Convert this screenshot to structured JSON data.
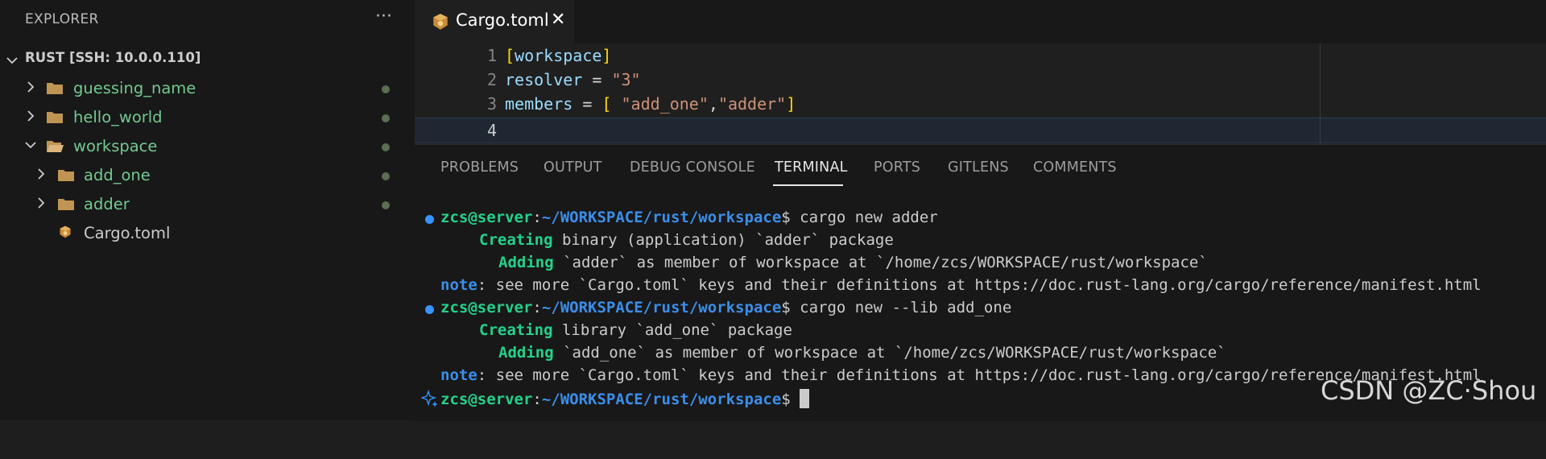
{
  "sidebar": {
    "title": "EXPLORER",
    "more_label": "···",
    "workspace_label": "RUST [SSH: 10.0.0.110]",
    "tree": [
      {
        "name": "guessing_name"
      },
      {
        "name": "hello_world"
      },
      {
        "name": "workspace"
      },
      {
        "name": "add_one"
      },
      {
        "name": "adder"
      },
      {
        "name": "Cargo.toml"
      }
    ]
  },
  "tab": {
    "label": "Cargo.toml",
    "close": "✕"
  },
  "editor": {
    "line_numbers": [
      "1",
      "2",
      "3",
      "4"
    ],
    "lines": [
      [
        "[",
        "workspace",
        "]"
      ],
      [
        "resolver",
        " = ",
        "\"3\""
      ],
      [
        "members",
        " = ",
        "[",
        " ",
        "\"add_one\"",
        ",",
        "\"adder\"",
        "]"
      ]
    ]
  },
  "panel": {
    "tabs": [
      "PROBLEMS",
      "OUTPUT",
      "DEBUG CONSOLE",
      "TERMINAL",
      "PORTS",
      "GITLENS",
      "COMMENTS"
    ],
    "active_tab": "TERMINAL"
  },
  "terminal": {
    "user_host": "zcs@server",
    "colon": ":",
    "path": "~/WORKSPACE/rust/workspace",
    "dollar": "$",
    "cmd1": " cargo new adder",
    "creating_word": "Creating",
    "adding_word": "Adding",
    "note_word": "note",
    "creating1_rest": " binary (application) `adder` package",
    "adding1_rest": " `adder` as member of workspace at `/home/zcs/WORKSPACE/rust/workspace`",
    "note_rest": ": see more `Cargo.toml` keys and their definitions at https://doc.rust-lang.org/cargo/reference/manifest.html",
    "cmd2": " cargo new --lib add_one",
    "creating2_rest": " library `add_one` package",
    "adding2_rest": " `add_one` as member of workspace at `/home/zcs/WORKSPACE/rust/workspace`"
  },
  "watermark": "CSDN @ZC·Shou",
  "colors": {
    "accent": "#3794ff",
    "green": "#23d18b",
    "folder_green": "#73c991"
  }
}
